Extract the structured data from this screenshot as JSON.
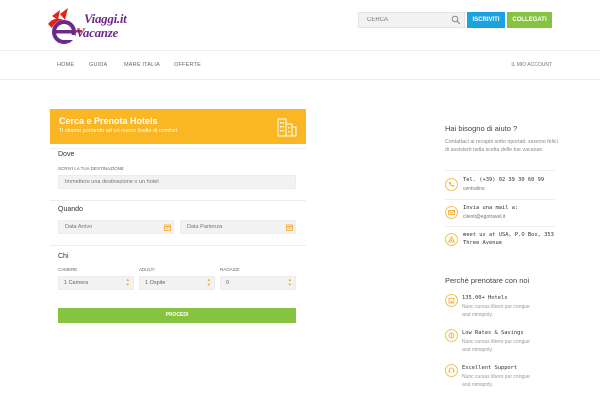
{
  "header": {
    "logo_line1": "Viaggi.it",
    "logo_line2": "Vacanze",
    "search_placeholder": "CERCA",
    "signup_label": "ISCRIVITI",
    "login_label": "COLLEGATI"
  },
  "nav": {
    "items": [
      "HOME",
      "GUIDA",
      "MARE ITALIA",
      "OFFERTE"
    ],
    "account": "IL MIO ACCOUNT"
  },
  "booking": {
    "title": "Cerca e Prenota Hotels",
    "subtitle": "Ti stiamo portando ad un nuovo livello di comfort",
    "where_label": "Dove",
    "destination_label": "SCRIVI LA TUA DESTINAZIONE",
    "destination_placeholder": "Immettere una destinazione o un hotel",
    "when_label": "Quando",
    "checkin_placeholder": "Data Arrivo",
    "checkout_placeholder": "Data Partenza",
    "who_label": "Chi",
    "rooms_label": "CAMERE",
    "rooms_value": "1 Camera",
    "adults_label": "ADULTI",
    "adults_value": "1 Ospite",
    "kids_label": "RAGAZZI",
    "kids_value": "0",
    "submit_label": "PROCEDI"
  },
  "help": {
    "title": "Hai bisogno di aiuto ?",
    "text": "Contattaci ai recapiti sotto riportati: saremo felici di assisterti nella scelta delle tue vacanze.",
    "phone": "Tel. (+39)  02 39 30 60 99",
    "phone_sub": "centralino",
    "email_title": "Invia una mail a:",
    "email": "clienti@egotravel.it",
    "address": "meet us at USA, P.O Box, 353 Three Avenue"
  },
  "why": {
    "title": "Perchè prenotare con noi",
    "features": [
      {
        "title": "135,00+ Hotels",
        "desc": "Nunc cursus libero pur congue arut nimspnty."
      },
      {
        "title": "Low Rates & Savings",
        "desc": "Nunc cursus libero pur congue arut nimspnty."
      },
      {
        "title": "Excellent Support",
        "desc": "Nunc cursus libero pur congue arut nimspnty."
      }
    ]
  },
  "colors": {
    "accent_yellow": "#fbb624",
    "signup_blue": "#1ba3e0",
    "green": "#86c440",
    "logo_purple": "#6a2a8c",
    "logo_red": "#e2231a"
  }
}
